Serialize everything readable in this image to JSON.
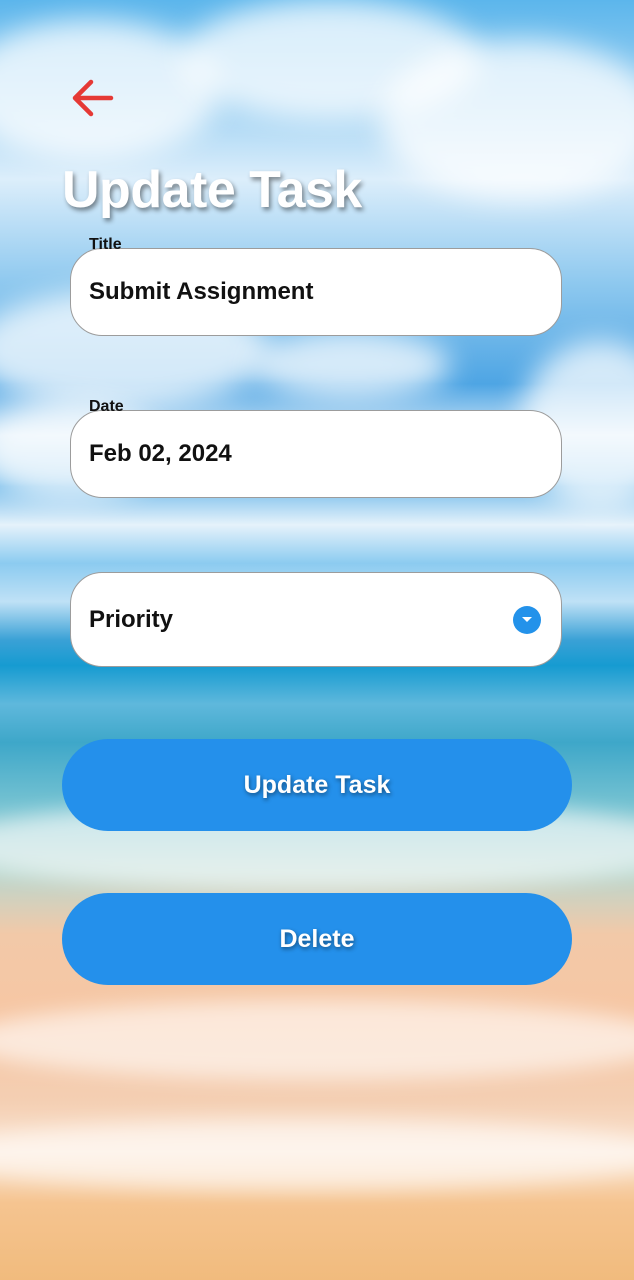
{
  "header": {
    "title": "Update Task"
  },
  "form": {
    "title_field": {
      "label": "Title",
      "value": "Submit Assignment"
    },
    "date_field": {
      "label": "Date",
      "value": "Feb 02, 2024"
    },
    "priority_field": {
      "placeholder": "Priority"
    }
  },
  "actions": {
    "update_label": "Update Task",
    "delete_label": "Delete"
  },
  "colors": {
    "accent": "#2490eb",
    "back_arrow": "#e53935",
    "field_bg": "#ffffff"
  },
  "icons": {
    "back": "arrow-left-icon",
    "dropdown": "chevron-down-circle-icon"
  }
}
